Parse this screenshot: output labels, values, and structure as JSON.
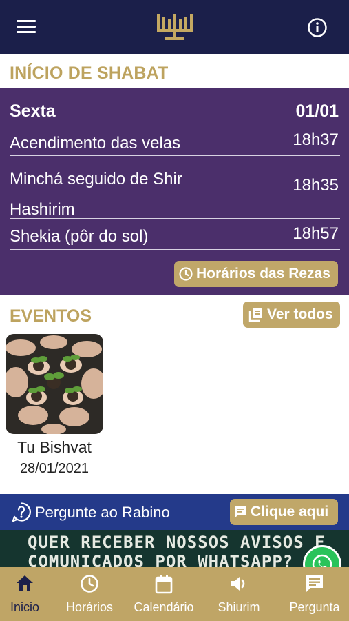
{
  "header": {
    "menu_icon": "hamburger-menu-icon",
    "logo_icon": "menorah-icon",
    "info_icon": "info-icon",
    "colors": {
      "bar": "#1b1f4a",
      "gold": "#bda35f"
    }
  },
  "shabat": {
    "title": "INÍCIO DE SHABAT",
    "day_label": "Sexta",
    "day_date": "01/01",
    "rows": [
      {
        "label": "Acendimento das velas",
        "time": "18h37"
      },
      {
        "label": "Minchá seguido de Shir Hashirim",
        "time": "18h35"
      },
      {
        "label": "Shekia (pôr do sol)",
        "time": "18h57"
      }
    ],
    "button_label": "Horários das Rezas",
    "button_icon": "clock-icon",
    "panel_color": "#4b2f6b"
  },
  "eventos": {
    "title": "EVENTOS",
    "button_label": "Ver todos",
    "button_icon": "collections-icon",
    "items": [
      {
        "name": "Tu Bishvat",
        "date": "28/01/2021",
        "image": "hands-holding-seedlings-photo"
      }
    ]
  },
  "rabino": {
    "label": "Pergunte ao Rabino",
    "icon": "question-circle-icon",
    "button_label": "Clique aqui",
    "button_icon": "chat-icon"
  },
  "banner": {
    "line1": "QUER RECEBER NOSSOS AVISOS E",
    "line2": "COMUNICADOS POR WHATSAPP?",
    "icon": "whatsapp-icon"
  },
  "bottom_nav": {
    "items": [
      {
        "label": "Inicio",
        "icon": "home-icon",
        "active": true
      },
      {
        "label": "Horários",
        "icon": "clock-icon",
        "active": false
      },
      {
        "label": "Calendário",
        "icon": "calendar-icon",
        "active": false
      },
      {
        "label": "Shiurim",
        "icon": "speaker-icon",
        "active": false
      },
      {
        "label": "Pergunta",
        "icon": "message-icon",
        "active": false
      }
    ]
  }
}
